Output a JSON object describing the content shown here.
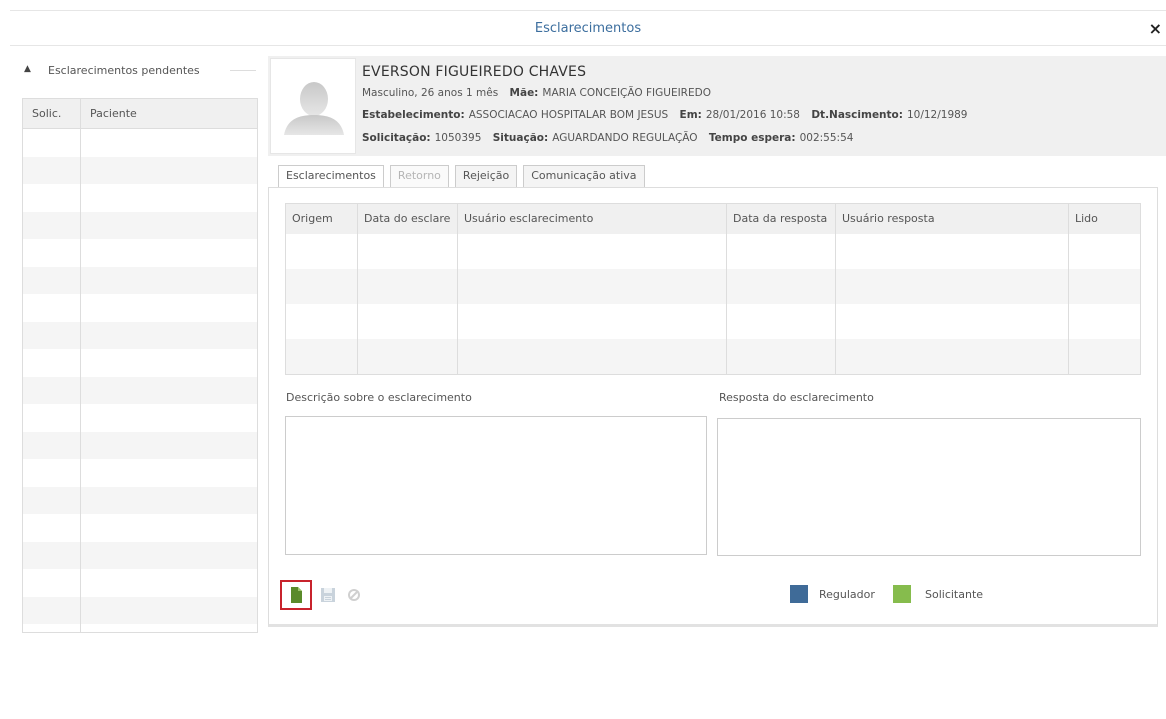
{
  "dialog": {
    "title": "Esclarecimentos",
    "close_label": "×"
  },
  "sidebar": {
    "arrow": "▲",
    "title": "Esclarecimentos pendentes",
    "columns": [
      "Solic.",
      "Paciente"
    ]
  },
  "patient": {
    "name": "EVERSON FIGUEIREDO CHAVES",
    "gender_age": "Masculino, 26 anos 1 mês",
    "mother_label": "Mãe:",
    "mother": "MARIA CONCEIÇÃO FIGUEIREDO",
    "establishment_label": "Estabelecimento:",
    "establishment": "ASSOCIACAO HOSPITALAR BOM JESUS",
    "em_label": "Em:",
    "em": "28/01/2016 10:58",
    "birth_label": "Dt.Nascimento:",
    "birth": "10/12/1989",
    "request_label": "Solicitação:",
    "request": "1050395",
    "status_label": "Situação:",
    "status": "AGUARDANDO REGULAÇÃO",
    "wait_label": "Tempo espera:",
    "wait": "002:55:54"
  },
  "tabs": [
    {
      "label": "Esclarecimentos"
    },
    {
      "label": "Retorno"
    },
    {
      "label": "Rejeição"
    },
    {
      "label": "Comunicação ativa"
    }
  ],
  "grid": {
    "columns": [
      "Origem",
      "Data do esclare",
      "Usuário esclarecimento",
      "Data da resposta",
      "Usuário resposta",
      "Lido"
    ]
  },
  "form": {
    "description_label": "Descrição sobre o esclarecimento",
    "response_label": "Resposta do esclarecimento"
  },
  "legend": {
    "regulator_label": "Regulador",
    "regulator_color": "#3f6b98",
    "requester_label": "Solicitante",
    "requester_color": "#86bc4d"
  },
  "icons": {
    "new": "new-document-icon",
    "save": "save-icon",
    "cancel": "cancel-icon",
    "close": "close-icon",
    "collapse": "collapse-arrow-icon",
    "avatar": "user-avatar-icon"
  }
}
